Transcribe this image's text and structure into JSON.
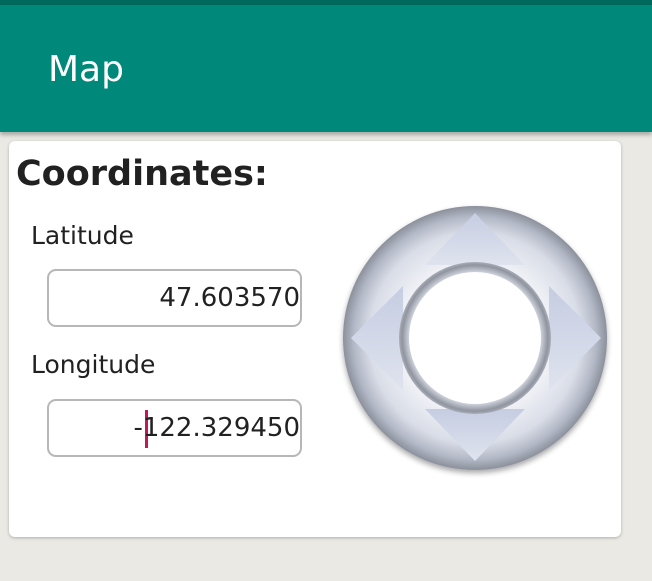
{
  "app": {
    "title": "Map"
  },
  "coordinates": {
    "heading": "Coordinates:",
    "latitude": {
      "label": "Latitude",
      "value": "47.603570"
    },
    "longitude": {
      "label": "Longitude",
      "value": "-122.329450"
    }
  },
  "dpad": {
    "icon": "dpad-icon",
    "buttons": [
      "up",
      "down",
      "left",
      "right",
      "center"
    ]
  },
  "colors": {
    "appbar": "#00897b",
    "statusbar": "#00695c",
    "caret": "#c2185b",
    "background": "#ebe9e4"
  }
}
